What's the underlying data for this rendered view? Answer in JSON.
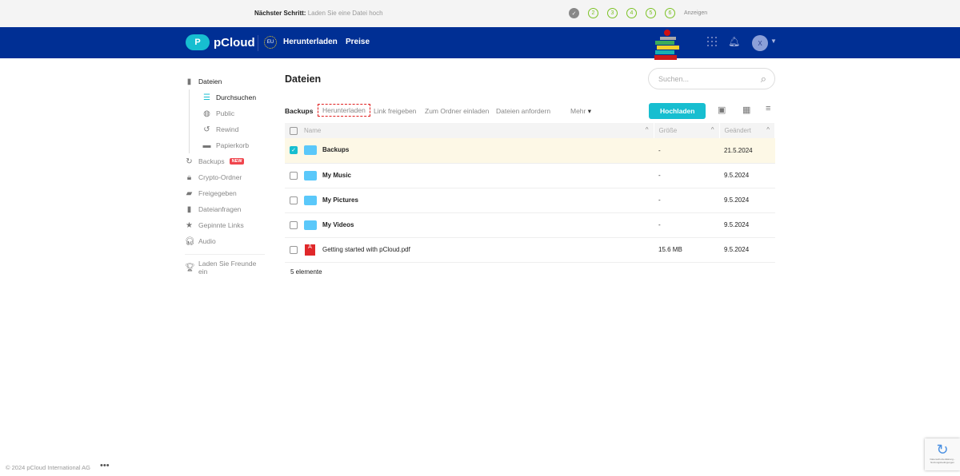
{
  "topbar": {
    "next_label": "Nächster Schritt:",
    "next_text": "Laden Sie eine Datei hoch",
    "steps": [
      "✓",
      "2",
      "3",
      "4",
      "5",
      "6"
    ],
    "show": "Anzeigen"
  },
  "nav": {
    "brand": "pCloud",
    "eu": "EU",
    "download": "Herunterladen",
    "pricing": "Preise",
    "avatar": "X"
  },
  "sidebar": {
    "files": "Dateien",
    "browse": "Durchsuchen",
    "public": "Public",
    "rewind": "Rewind",
    "trash": "Papierkorb",
    "backups": "Backups",
    "new_badge": "NEW",
    "crypto": "Crypto-Ordner",
    "shared": "Freigegeben",
    "requests": "Dateianfragen",
    "pinned": "Gepinnte Links",
    "audio": "Audio",
    "invite": "Laden Sie Freunde ein"
  },
  "main": {
    "title": "Dateien",
    "search_placeholder": "Suchen...",
    "toolbar": {
      "selected": "Backups",
      "download": "Herunterladen",
      "share_link": "Link freigeben",
      "invite_folder": "Zum Ordner einladen",
      "request_files": "Dateien anfordern",
      "more": "Mehr",
      "upload": "Hochladen"
    },
    "columns": {
      "name": "Name",
      "size": "Größe",
      "modified": "Geändert"
    },
    "rows": [
      {
        "name": "Backups",
        "size": "-",
        "modified": "21.5.2024"
      },
      {
        "name": "My Music",
        "size": "-",
        "modified": "9.5.2024"
      },
      {
        "name": "My Pictures",
        "size": "-",
        "modified": "9.5.2024"
      },
      {
        "name": "My Videos",
        "size": "-",
        "modified": "9.5.2024"
      },
      {
        "name": "Getting started with pCloud.pdf",
        "size": "15.6 MB",
        "modified": "9.5.2024"
      }
    ],
    "count": "5 elemente"
  },
  "footer": {
    "copyright": "© 2024 pCloud International AG",
    "recaptcha": "Datenschutzerklärung - Nutzungsbedingungen"
  }
}
